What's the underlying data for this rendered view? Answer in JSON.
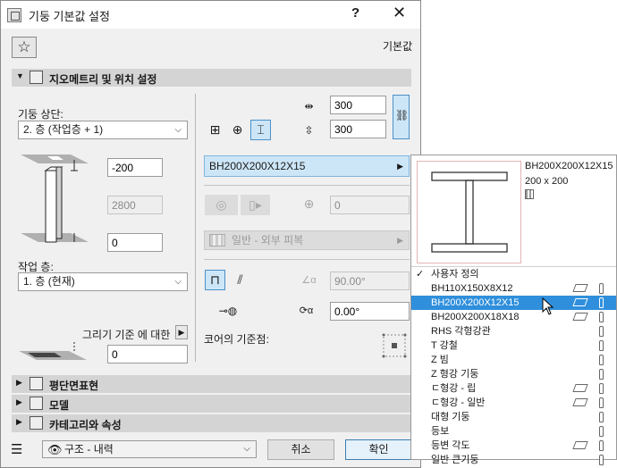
{
  "window": {
    "title": "기둥 기본값 설정",
    "help": "?",
    "close": "✕"
  },
  "toolbar": {
    "favorites_icon": "☆",
    "default_label": "기본값"
  },
  "sections": {
    "geometry": {
      "arrow": "▼",
      "label": "지오메트리 및 위치 설정"
    },
    "floor_plan": {
      "arrow": "▶",
      "label": "평단면표현"
    },
    "model": {
      "arrow": "▶",
      "label": "모델"
    },
    "category": {
      "arrow": "▶",
      "label": "카테고리와 속성"
    }
  },
  "left": {
    "top_label": "기둥 상단:",
    "top_value": "2. 층 (작업층 + 1)",
    "offset_top": "-200",
    "height": "2800",
    "offset_bottom": "0",
    "home_story_label": "작업 층:",
    "home_story_value": "1. 층 (현재)",
    "relative_label": "그리기 기준 에 대한",
    "relative_value": "0"
  },
  "right": {
    "width": "300",
    "depth": "300",
    "profile": "BH200X200X12X15",
    "disabled_value": "0",
    "surface": "일반 - 외부 피복",
    "slant_angle": "90.00°",
    "rotation_angle": "0.00°",
    "anchor_label": "코어의 기준점:"
  },
  "bottom": {
    "layer": "구조 - 내력",
    "cancel": "취소",
    "ok": "확인"
  },
  "popup": {
    "profile_name": "BH200X200X12X15",
    "profile_size": "200 x 200",
    "items": [
      {
        "label": "사용자 정의",
        "checked": true
      },
      {
        "label": "BH110X150X8X12"
      },
      {
        "label": "BH200X200X12X15",
        "selected": true
      },
      {
        "label": "BH200X200X18X18"
      },
      {
        "label": "RHS 각형강관"
      },
      {
        "label": "T 강철"
      },
      {
        "label": "Z 빔"
      },
      {
        "label": "Z 형강 기둥"
      },
      {
        "label": "ㄷ형강 - 립"
      },
      {
        "label": "ㄷ형강 - 일반"
      },
      {
        "label": "대형 기둥"
      },
      {
        "label": "등보"
      },
      {
        "label": "등변 각도"
      },
      {
        "label": "일반 큰기둥"
      }
    ]
  },
  "colors": {
    "selection": "#2f8fdc",
    "highlight": "#cde6f7",
    "section": "#d4d4d4"
  }
}
